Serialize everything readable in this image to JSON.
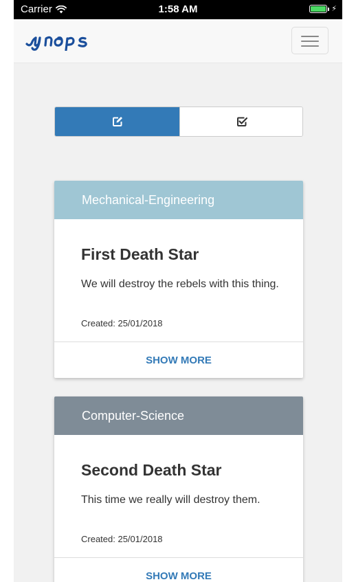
{
  "status_bar": {
    "carrier": "Carrier",
    "time": "1:58 AM",
    "battery_level": 1.0,
    "battery_color": "#4cd964"
  },
  "navbar": {
    "logo_text": "synaps",
    "menu_icon": "hamburger-icon"
  },
  "toggle": {
    "options": [
      {
        "icon": "edit-checkbox-icon",
        "active": true
      },
      {
        "icon": "checked-checkbox-icon",
        "active": false
      }
    ],
    "active_color": "#337ab7"
  },
  "cards": [
    {
      "category": "Mechanical-Engineering",
      "category_color": "#9fc6d4",
      "title": "First Death Star",
      "description": "We will destroy the rebels with this thing.",
      "created": "Created: 25/01/2018",
      "action": "SHOW MORE"
    },
    {
      "category": "Computer-Science",
      "category_color": "#7f8c97",
      "title": "Second Death Star",
      "description": "This time we really will destroy them.",
      "created": "Created: 25/01/2018",
      "action": "SHOW MORE"
    }
  ]
}
